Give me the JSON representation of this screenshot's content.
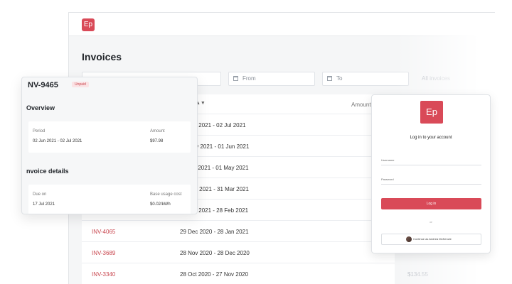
{
  "app": {
    "logo_text": "Ep",
    "page_title": "Invoices",
    "filters": {
      "from_placeholder": "From",
      "to_placeholder": "To",
      "status_placeholder": "All invoices"
    },
    "table": {
      "amount_header": "Amount",
      "rows": [
        {
          "invoice": "",
          "period": "02 Jun 2021 - 02 Jul 2021",
          "amount": ""
        },
        {
          "invoice": "",
          "period": "02 May 2021 - 01 Jun 2021",
          "amount": ""
        },
        {
          "invoice": "",
          "period": "01 Apr 2021 - 01 May 2021",
          "amount": ""
        },
        {
          "invoice": "",
          "period": "28 Feb 2021 - 31 Mar 2021",
          "amount": ""
        },
        {
          "invoice": "",
          "period": "28 Jan 2021 - 28 Feb 2021",
          "amount": ""
        },
        {
          "invoice": "INV-4065",
          "period": "29 Dec 2020 - 28 Jan 2021",
          "amount": ""
        },
        {
          "invoice": "INV-3689",
          "period": "28 Nov 2020 - 28 Dec 2020",
          "amount": ""
        },
        {
          "invoice": "INV-3340",
          "period": "28 Oct 2020 - 27 Nov 2020",
          "amount": "$134.55"
        }
      ]
    }
  },
  "detail": {
    "invoice_id": "NV-9465",
    "status_badge": "Unpaid",
    "overview_title": "Overview",
    "period_label": "Period",
    "period_value": "02 Jun 2021 - 02 Jul 2021",
    "amount_label": "Amount",
    "amount_value": "$97.98",
    "details_title": "nvoice details",
    "due_label": "Due on",
    "due_value": "17 Jul 2021",
    "base_cost_label": "Base usage cost",
    "base_cost_value": "$0.02/kWh"
  },
  "login": {
    "logo_text": "Ep",
    "title": "Log in to your account",
    "username_label": "Username",
    "password_label": "Password",
    "login_button": "Log in",
    "or_text": "or",
    "continue_button": "Continue as Andrea McKenzie"
  },
  "colors": {
    "brand": "#d94a58",
    "link": "#c9474f"
  }
}
